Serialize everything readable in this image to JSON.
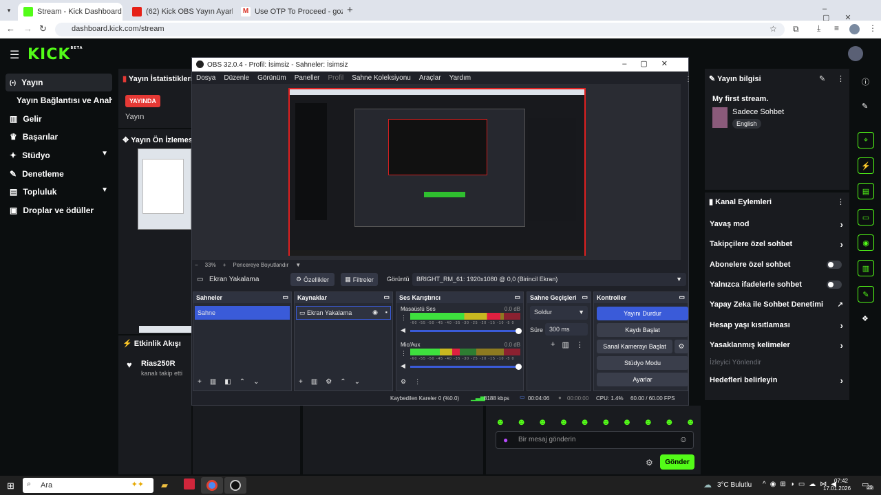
{
  "browser": {
    "tabs": [
      {
        "label": "Stream - Kick Dashboard"
      },
      {
        "label": "(62) Kick OBS Yayın Ayarları Na..."
      },
      {
        "label": "Use OTP To Proceed - gozyas..."
      }
    ],
    "url": "dashboard.kick.com/stream"
  },
  "kick": {
    "logo": "KICK",
    "logo_sup": "BETA",
    "nav": {
      "yayin": "Yayın",
      "yayin_baglantisi": "Yayın Bağlantısı ve Anahtarı",
      "gelir": "Gelir",
      "basarilar": "Başarılar",
      "studyo": "Stüdyo",
      "denetleme": "Denetleme",
      "topluluk": "Topluluk",
      "droplar": "Droplar ve ödüller"
    },
    "stats": {
      "title": "Yayın İstatistikleri",
      "live_badge": "YAYINDA",
      "label": "Yayın"
    },
    "preview": {
      "title": "Yayın Ön İzlemesi"
    },
    "activity": {
      "title": "Etkinlik Akışı",
      "user": "Rias250R",
      "action": "kanalı takip etti"
    },
    "stream_info": {
      "title": "Yayın bilgisi",
      "stream_title": "My first stream.",
      "category": "Sadece Sohbet",
      "language": "English"
    },
    "channel_actions": {
      "title": "Kanal Eylemleri",
      "slow_mode": "Yavaş mod",
      "followers_only": "Takipçilere özel sohbet",
      "subscribers_only": "Abonelere özel sohbet",
      "emotes_only": "Yalnızca ifadelerle sohbet",
      "ai_moderation": "Yapay Zeka ile Sohbet Denetimi",
      "age_restrictions": "Hesap yaşı kısıtlaması",
      "banned_words": "Yasaklanmış kelimeler",
      "raid": "İzleyici Yönlendir",
      "goals": "Hedefleri belirleyin"
    },
    "chat": {
      "placeholder": "Bir mesaj gönderin",
      "send": "Gönder"
    }
  },
  "obs": {
    "title": "OBS 32.0.4 - Profil: İsimsiz - Sahneler: İsimsiz",
    "menu": {
      "file": "Dosya",
      "edit": "Düzenle",
      "view": "Görünüm",
      "docks": "Paneller",
      "profile": "Profil",
      "collection": "Sahne Koleksiyonu",
      "tools": "Araçlar",
      "help": "Yardım"
    },
    "zoom": {
      "minus": "−",
      "value": "33%",
      "plus": "+",
      "fit": "Pencereye Boyutlandır"
    },
    "source_bar": {
      "source": "Ekran Yakalama",
      "properties": "Özellikler",
      "filters": "Filtreler",
      "display_label": "Görüntü",
      "display_value": "BRIGHT_RM_61: 1920x1080 @ 0,0 (Birincil Ekran)"
    },
    "scenes": {
      "title": "Sahneler",
      "item": "Sahne"
    },
    "sources": {
      "title": "Kaynaklar",
      "item": "Ekran Yakalama"
    },
    "mixer": {
      "title": "Ses Karıştırıcı",
      "ch1": {
        "name": "Masaüstü Ses",
        "db": "0.0 dB",
        "level": 0.82
      },
      "ch2": {
        "name": "Mic/Aux",
        "db": "0.0 dB",
        "level": 0.45
      },
      "scale": "-60 -55 -50 -45 -40 -35 -30 -25 -20 -15 -10 -5 0"
    },
    "transitions": {
      "title": "Sahne Geçişleri",
      "type": "Soldur",
      "duration_label": "Süre",
      "duration": "300 ms"
    },
    "controls": {
      "title": "Kontroller",
      "stop": "Yayını Durdur",
      "record": "Kaydı Başlat",
      "virtualcam": "Sanal Kamerayı Başlat",
      "studio": "Stüdyo Modu",
      "settings": "Ayarlar"
    },
    "status": {
      "dropped": "Kaybedilen Kareler 0 (%0.0)",
      "bitrate": "8188 kbps",
      "stream_time": "00:04:06",
      "rec_time": "00:00:00",
      "cpu": "CPU: 1.4%",
      "fps": "60.00 / 60.00 FPS"
    }
  },
  "taskbar": {
    "search": "Ara",
    "weather": "3°C Bulutlu",
    "time": "07:42",
    "date": "17.01.2026",
    "badge": "29"
  }
}
